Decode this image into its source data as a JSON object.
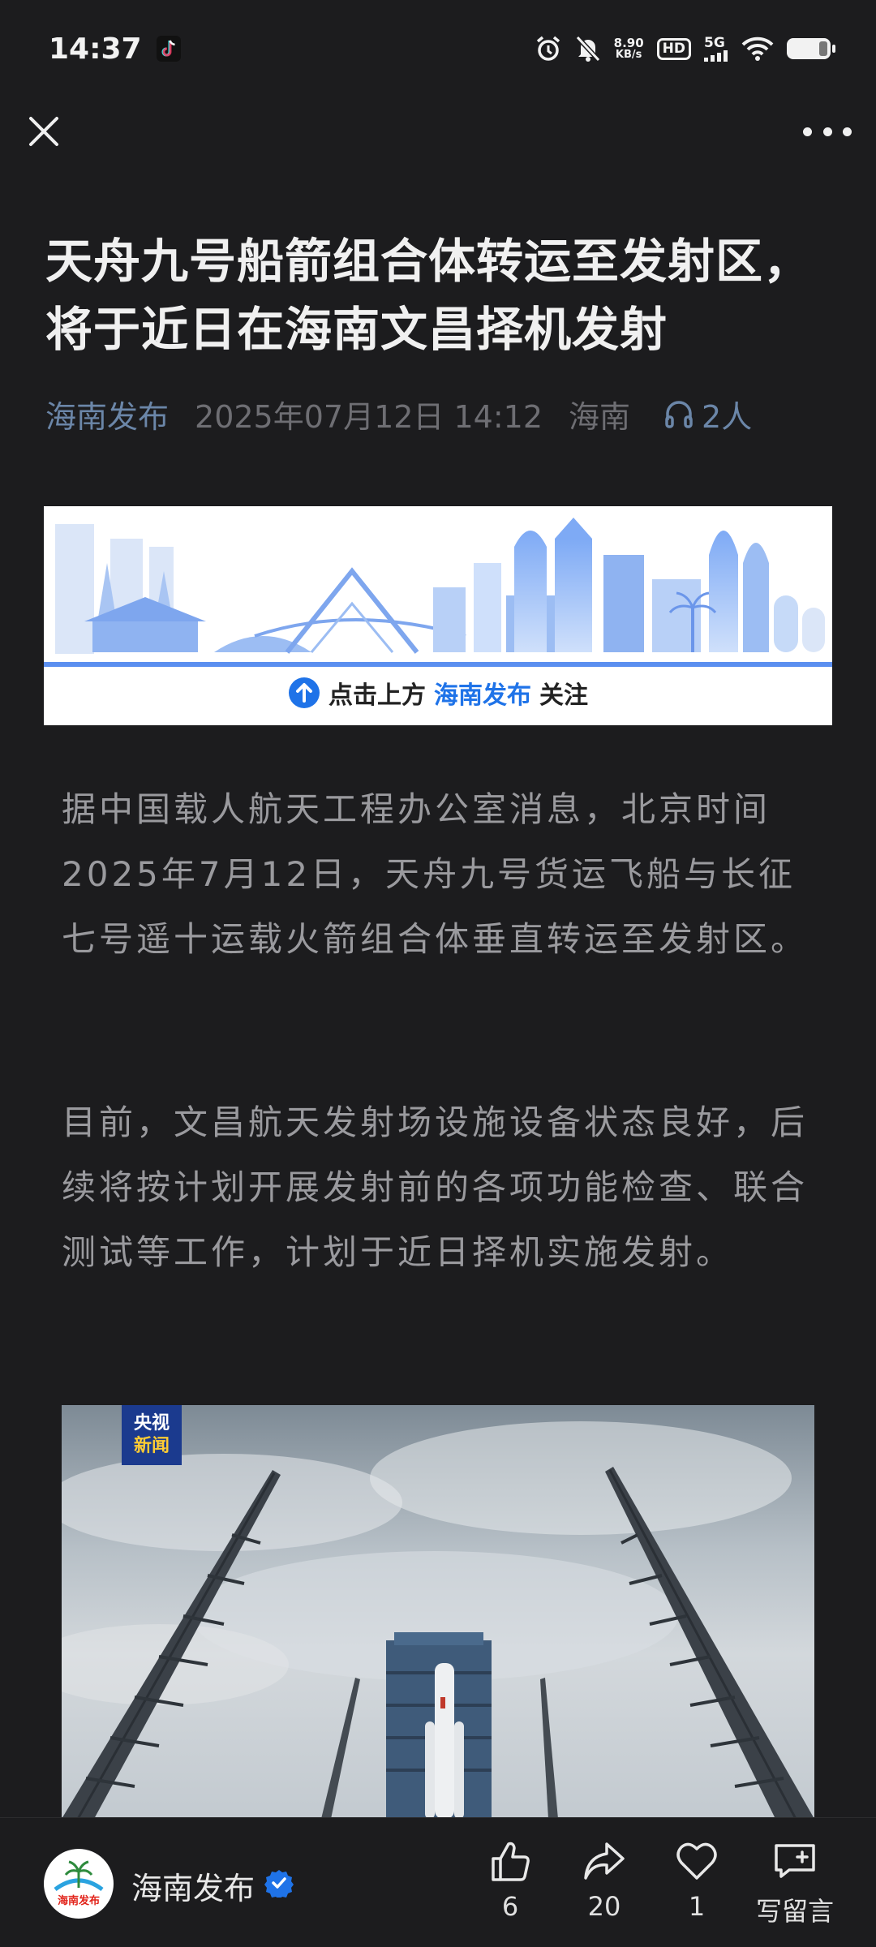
{
  "status_bar": {
    "time": "14:37",
    "net_speed_value": "8.90",
    "net_speed_unit": "KB/s",
    "hd_label": "HD",
    "network": "5G",
    "icons": [
      "tiktok-icon",
      "alarm-icon",
      "mute-icon",
      "wifi-icon",
      "battery-icon"
    ]
  },
  "nav": {
    "close_icon": "close-icon",
    "more_icon": "more-icon"
  },
  "article": {
    "title": "天舟九号船箭组合体转运至发射区，将于近日在海南文昌择机发射",
    "source": "海南发布",
    "date": "2025年07月12日 14:12",
    "region": "海南",
    "listeners": "2人",
    "banner": {
      "cta_prefix": "点击上方",
      "cta_brand": "海南发布",
      "cta_suffix": "关注"
    },
    "paragraphs": [
      "据中国载人航天工程办公室消息，北京时间2025年7月12日，天舟九号货运飞船与长征七号遥十运载火箭组合体垂直转运至发射区。",
      "目前，文昌航天发射场设施设备状态良好，后续将按计划开展发射前的各项功能检查、联合测试等工作，计划于近日择机实施发射。"
    ],
    "photo_logo_line1": "央视",
    "photo_logo_line2": "新闻"
  },
  "bottom_bar": {
    "account_name": "海南发布",
    "avatar_text": "海南发布",
    "like_count": "6",
    "share_count": "20",
    "favorite_count": "1",
    "comment_label": "写留言"
  },
  "colors": {
    "background": "#1c1c1e",
    "link_blue": "#6b86a8",
    "brand_blue": "#1f73e8"
  }
}
